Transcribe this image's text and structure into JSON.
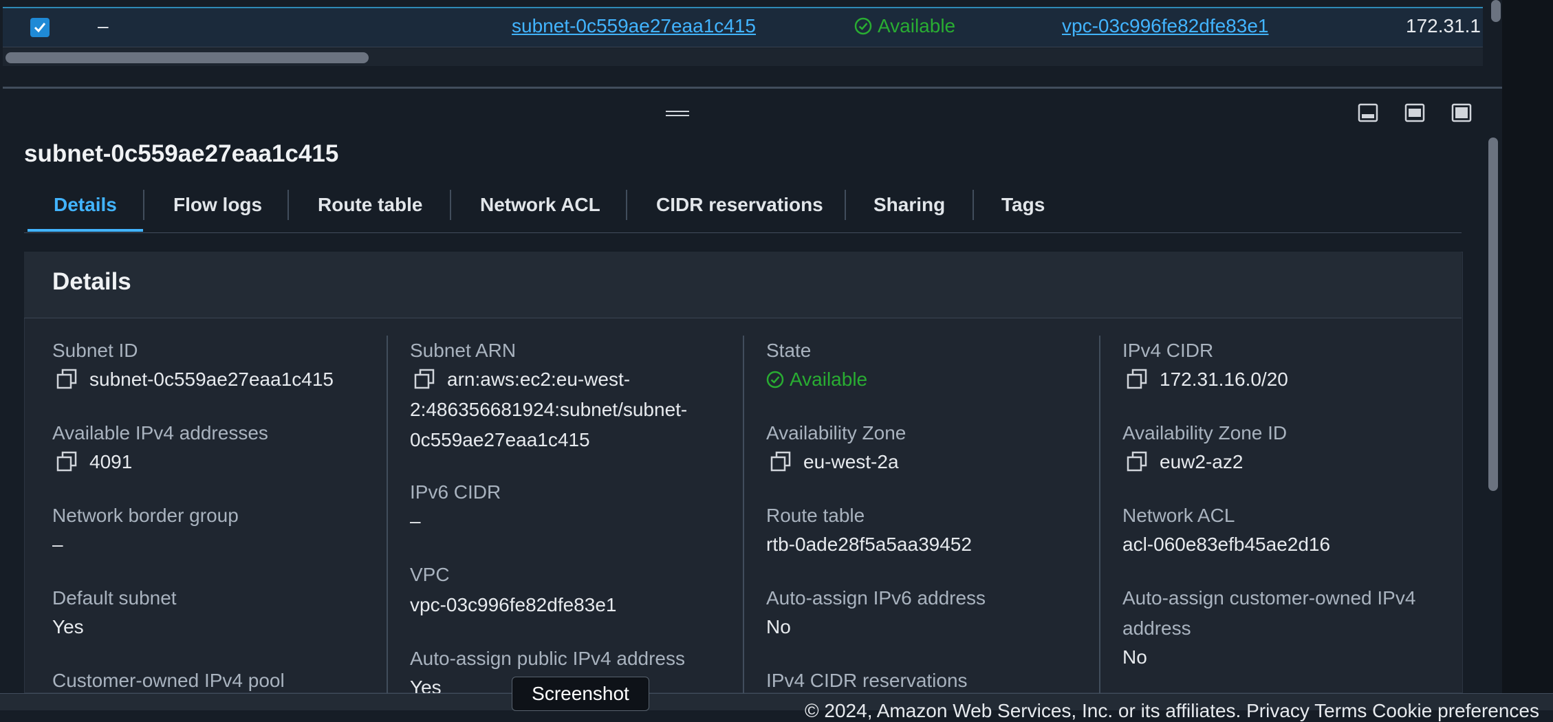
{
  "table_row": {
    "name": "–",
    "subnet_id": "subnet-0c559ae27eaa1c415",
    "state": "Available",
    "vpc": "vpc-03c996fe82dfe83e1",
    "cidr_truncated": "172.31.1"
  },
  "panel": {
    "title": "subnet-0c559ae27eaa1c415",
    "tabs": [
      {
        "label": "Details"
      },
      {
        "label": "Flow logs"
      },
      {
        "label": "Route table"
      },
      {
        "label": "Network ACL"
      },
      {
        "label": "CIDR reservations"
      },
      {
        "label": "Sharing"
      },
      {
        "label": "Tags"
      }
    ],
    "active_tab": "Details"
  },
  "details": {
    "heading": "Details",
    "col1": {
      "subnet_id_label": "Subnet ID",
      "subnet_id": "subnet-0c559ae27eaa1c415",
      "avail_ipv4_label": "Available IPv4 addresses",
      "avail_ipv4": "4091",
      "nbg_label": "Network border group",
      "nbg": "–",
      "default_subnet_label": "Default subnet",
      "default_subnet": "Yes",
      "coip_label": "Customer-owned IPv4 pool"
    },
    "col2": {
      "arn_label": "Subnet ARN",
      "arn_line1": "arn:aws:ec2:eu-west-",
      "arn_line2": "2:486356681924:subnet/subnet-",
      "arn_line3": "0c559ae27eaa1c415",
      "ipv6_cidr_label": "IPv6 CIDR",
      "ipv6_cidr": "–",
      "vpc_label": "VPC",
      "vpc": "vpc-03c996fe82dfe83e1",
      "auto_public_label": "Auto-assign public IPv4 address",
      "auto_public": "Yes"
    },
    "col3": {
      "state_label": "State",
      "state": "Available",
      "az_label": "Availability Zone",
      "az": "eu-west-2a",
      "route_table_label": "Route table",
      "route_table": "rtb-0ade28f5a5aa39452",
      "auto_ipv6_label": "Auto-assign IPv6 address",
      "auto_ipv6": "No",
      "ipv4_cidr_res_label": "IPv4 CIDR reservations"
    },
    "col4": {
      "ipv4_cidr_label": "IPv4 CIDR",
      "ipv4_cidr": "172.31.16.0/20",
      "az_id_label": "Availability Zone ID",
      "az_id": "euw2-az2",
      "nacl_label": "Network ACL",
      "nacl": "acl-060e83efb45ae2d16",
      "auto_coip_label_line1": "Auto-assign customer-owned IPv4",
      "auto_coip_label_line2": "address",
      "auto_coip": "No"
    }
  },
  "footer": {
    "text": "© 2024, Amazon Web Services, Inc. or its affiliates.   Privacy   Terms   Cookie preferences"
  },
  "tooltip": {
    "text": "Screenshot"
  },
  "colors": {
    "accent": "#42b4ff",
    "success": "#29ad32",
    "background": "#161d26"
  }
}
